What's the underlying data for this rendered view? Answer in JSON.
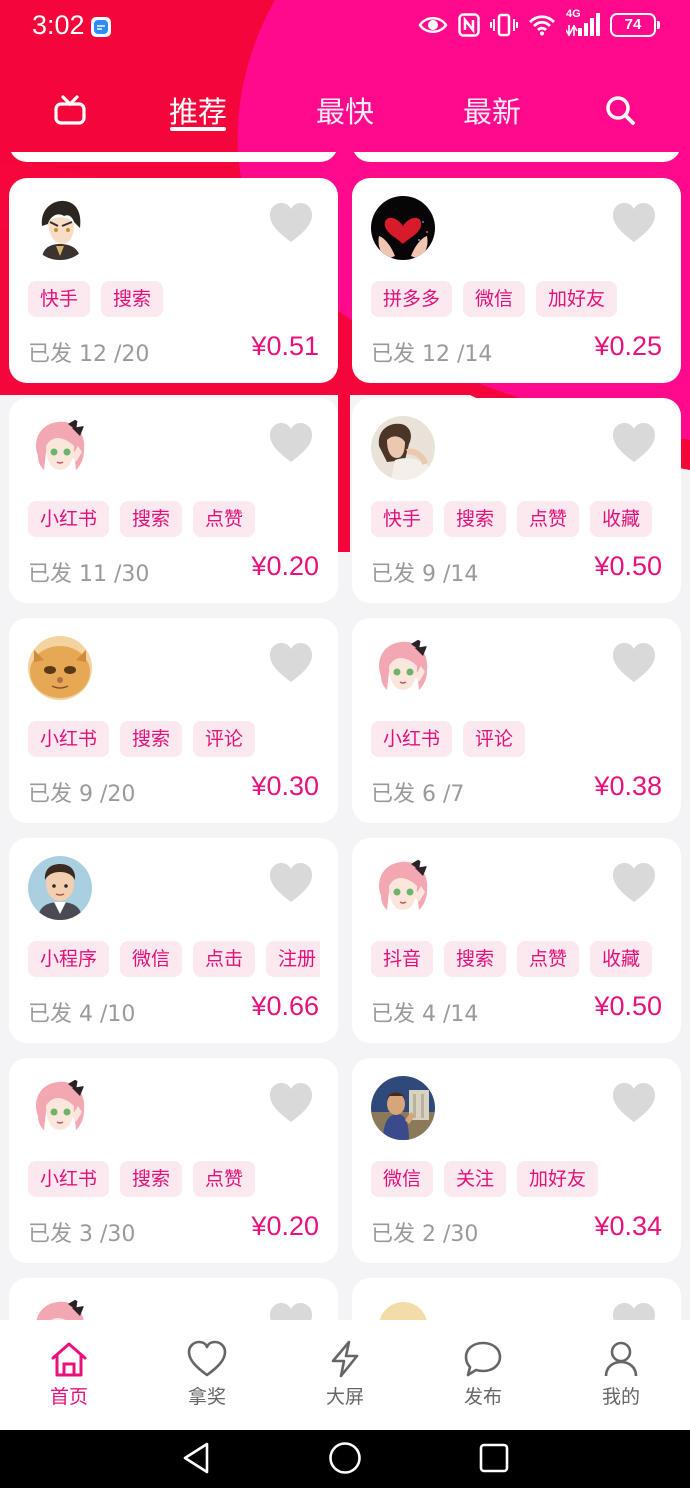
{
  "status_bar": {
    "time": "3:02",
    "battery": "74",
    "network": "4G",
    "icons": [
      "message-icon",
      "eye-icon",
      "nfc-icon",
      "vibrate-icon",
      "wifi-icon",
      "signal-icon",
      "battery-icon"
    ]
  },
  "top_nav": {
    "tabs": [
      {
        "label": "推荐",
        "active": true
      },
      {
        "label": "最快",
        "active": false
      },
      {
        "label": "最新",
        "active": false
      }
    ],
    "left_icon": "tv-icon",
    "right_icon": "search-icon"
  },
  "colors": {
    "brand": "#e8117b",
    "hero_magenta": "#ff0a8c",
    "hero_red": "#f5063a",
    "tag_bg": "#fce8ef",
    "tag_text": "#e0127a"
  },
  "tasks": [
    {
      "avatar": "anime-boy-avatar",
      "tags": [
        "快手",
        "搜索"
      ],
      "sent": "已发 12 /20",
      "price": "¥0.51"
    },
    {
      "avatar": "heart-hands-avatar",
      "tags": [
        "拼多多",
        "微信",
        "加好友"
      ],
      "sent": "已发 12 /14",
      "price": "¥0.25"
    },
    {
      "avatar": "anime-girl-avatar",
      "tags": [
        "小红书",
        "搜索",
        "点赞"
      ],
      "sent": "已发 11 /30",
      "price": "¥0.20"
    },
    {
      "avatar": "woman-photo-avatar",
      "tags": [
        "快手",
        "搜索",
        "点赞",
        "收藏"
      ],
      "sent": "已发 9 /14",
      "price": "¥0.50"
    },
    {
      "avatar": "cat-avatar",
      "tags": [
        "小红书",
        "搜索",
        "评论"
      ],
      "sent": "已发 9 /20",
      "price": "¥0.30"
    },
    {
      "avatar": "anime-girl-avatar",
      "tags": [
        "小红书",
        "评论"
      ],
      "sent": "已发 6 /7",
      "price": "¥0.38"
    },
    {
      "avatar": "cartoon-man-avatar",
      "tags": [
        "小程序",
        "微信",
        "点击",
        "注册"
      ],
      "sent": "已发 4 /10",
      "price": "¥0.66"
    },
    {
      "avatar": "anime-girl-avatar",
      "tags": [
        "抖音",
        "搜索",
        "点赞",
        "收藏"
      ],
      "sent": "已发 4 /14",
      "price": "¥0.50"
    },
    {
      "avatar": "anime-girl-avatar",
      "tags": [
        "小红书",
        "搜索",
        "点赞"
      ],
      "sent": "已发 3 /30",
      "price": "¥0.20"
    },
    {
      "avatar": "painting-avatar",
      "tags": [
        "微信",
        "关注",
        "加好友"
      ],
      "sent": "已发 2 /30",
      "price": "¥0.34"
    },
    {
      "avatar": "anime-girl-avatar",
      "tags": [],
      "sent": "",
      "price": ""
    },
    {
      "avatar": "blonde-anime-avatar",
      "tags": [],
      "sent": "",
      "price": ""
    }
  ],
  "bottom_nav": [
    {
      "label": "首页",
      "icon": "home-icon",
      "active": true
    },
    {
      "label": "拿奖",
      "icon": "heart-icon",
      "active": false
    },
    {
      "label": "大屏",
      "icon": "lightning-icon",
      "active": false
    },
    {
      "label": "发布",
      "icon": "chat-bubble-icon",
      "active": false
    },
    {
      "label": "我的",
      "icon": "person-icon",
      "active": false
    }
  ],
  "system_nav": [
    "back-icon",
    "home-circle-icon",
    "recents-icon"
  ]
}
